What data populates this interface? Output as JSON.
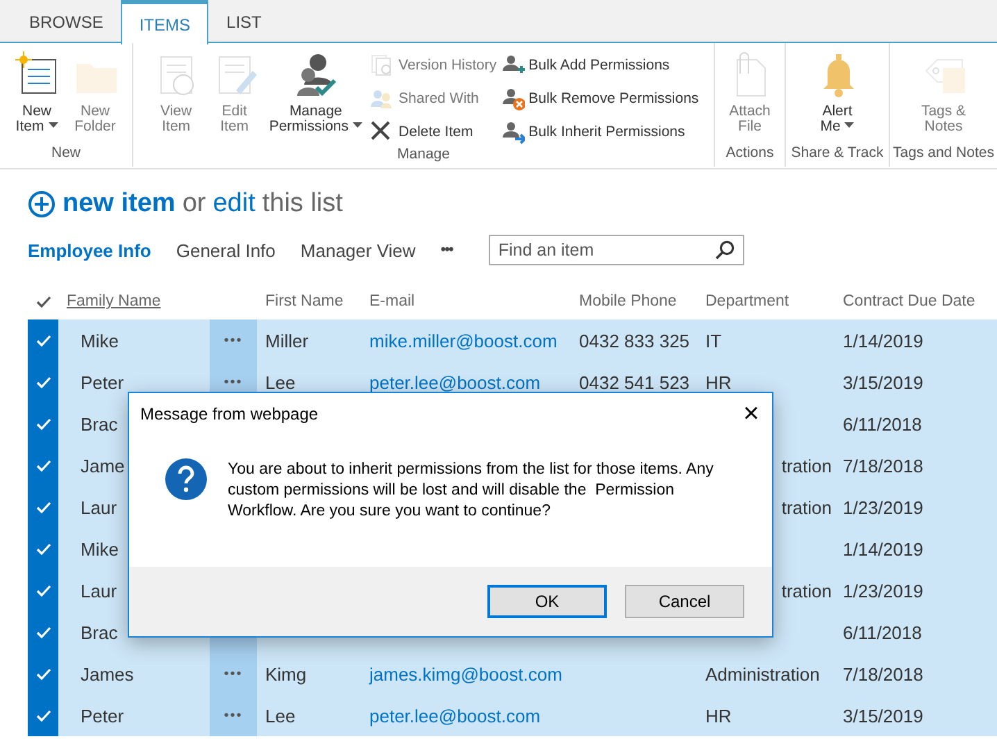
{
  "ribbon": {
    "tabs": [
      {
        "label": "BROWSE",
        "selected": false
      },
      {
        "label": "ITEMS",
        "selected": true
      },
      {
        "label": "LIST",
        "selected": false
      }
    ],
    "groups": [
      {
        "name": "New",
        "columns": [
          [
            {
              "kind": "large",
              "label_lines": [
                "New",
                "Item"
              ],
              "dropdown": true,
              "disabled": false
            }
          ],
          [
            {
              "kind": "large",
              "label_lines": [
                "New",
                "Folder"
              ],
              "dropdown": false,
              "disabled": true
            }
          ]
        ]
      },
      {
        "name": "Manage",
        "columns": [
          [
            {
              "kind": "large",
              "label_lines": [
                "View",
                "Item"
              ],
              "dropdown": false,
              "disabled": true
            }
          ],
          [
            {
              "kind": "large",
              "label_lines": [
                "Edit",
                "Item"
              ],
              "dropdown": false,
              "disabled": true
            }
          ],
          [
            {
              "kind": "large",
              "label_lines": [
                "Manage",
                "Permissions"
              ],
              "dropdown": true,
              "disabled": false
            }
          ],
          [
            {
              "kind": "small",
              "label_lines": [
                "Version History"
              ],
              "dropdown": false,
              "disabled": true
            },
            {
              "kind": "small",
              "label_lines": [
                "Shared With"
              ],
              "dropdown": false,
              "disabled": true
            },
            {
              "kind": "small",
              "label_lines": [
                "Delete Item"
              ],
              "dropdown": false,
              "disabled": false
            }
          ],
          [
            {
              "kind": "small",
              "label_lines": [
                "Bulk Add Permissions"
              ],
              "dropdown": false,
              "disabled": false
            },
            {
              "kind": "small",
              "label_lines": [
                "Bulk Remove Permissions"
              ],
              "dropdown": false,
              "disabled": false
            },
            {
              "kind": "small",
              "label_lines": [
                "Bulk Inherit Permissions"
              ],
              "dropdown": false,
              "disabled": false
            }
          ]
        ]
      },
      {
        "name": "Actions",
        "columns": [
          [
            {
              "kind": "large",
              "label_lines": [
                "Attach",
                "File"
              ],
              "dropdown": false,
              "disabled": true
            }
          ]
        ]
      },
      {
        "name": "Share & Track",
        "columns": [
          [
            {
              "kind": "large",
              "label_lines": [
                "Alert",
                "Me"
              ],
              "dropdown": true,
              "disabled": false
            }
          ]
        ]
      },
      {
        "name": "Tags and Notes",
        "columns": [
          [
            {
              "kind": "large",
              "label_lines": [
                "Tags &",
                "Notes"
              ],
              "dropdown": false,
              "disabled": true
            }
          ]
        ]
      }
    ]
  },
  "list": {
    "heading": {
      "new_item": "new item",
      "or": "or",
      "edit": "edit",
      "rest": "this list"
    },
    "views": [
      {
        "label": "Employee Info",
        "selected": true
      },
      {
        "label": "General Info",
        "selected": false
      },
      {
        "label": "Manager View",
        "selected": false
      }
    ],
    "more_views": "•••",
    "search": {
      "placeholder": "Find an item"
    },
    "columns": [
      {
        "label": "Family Name",
        "sorted": true
      },
      {
        "label": "First Name",
        "sorted": false
      },
      {
        "label": "E-mail",
        "sorted": false
      },
      {
        "label": "Mobile Phone",
        "sorted": false
      },
      {
        "label": "Department",
        "sorted": false
      },
      {
        "label": "Contract Due Date",
        "sorted": false
      }
    ],
    "rows": [
      {
        "kind": "full",
        "selected": true,
        "family_name": "Mike",
        "menu": "•••",
        "first_name": "Miller",
        "email": "mike.miller@boost.com",
        "mobile_phone": "0432 833 325",
        "department": "IT",
        "contract_due_date": "1/14/2019"
      },
      {
        "kind": "full",
        "selected": true,
        "family_name": "Peter",
        "menu": "•••",
        "first_name": "Lee",
        "email": "peter.lee@boost.com",
        "mobile_phone": "0432 541 523",
        "department": "HR",
        "contract_due_date": "3/15/2019"
      },
      {
        "kind": "covered",
        "selected": true,
        "family_name": "Brac",
        "contract_due_date": "6/11/2018"
      },
      {
        "kind": "covered",
        "selected": true,
        "family_name": "Jame",
        "department": "tration",
        "contract_due_date": "7/18/2018"
      },
      {
        "kind": "covered",
        "selected": true,
        "family_name": "Laur",
        "department": "tration",
        "contract_due_date": "1/23/2019"
      },
      {
        "kind": "covered",
        "selected": true,
        "family_name": "Mike",
        "contract_due_date": "1/14/2019"
      },
      {
        "kind": "covered",
        "selected": true,
        "family_name": "Laur",
        "department": "tration",
        "contract_due_date": "1/23/2019"
      },
      {
        "kind": "covered",
        "selected": true,
        "family_name": "Brac",
        "contract_due_date": "6/11/2018"
      },
      {
        "kind": "full",
        "selected": true,
        "family_name": "James",
        "menu": "•••",
        "first_name": "Kimg",
        "email": "james.kimg@boost.com",
        "department": "Administration",
        "contract_due_date": "7/18/2018"
      },
      {
        "kind": "full",
        "selected": true,
        "family_name": "Peter",
        "menu": "•••",
        "first_name": "Lee",
        "email": "peter.lee@boost.com",
        "department": "HR",
        "contract_due_date": "3/15/2019"
      }
    ]
  },
  "dialog": {
    "title": "Message from webpage",
    "close": "×",
    "message": "You are about to inherit permissions from the list for those items. Any custom permissions will be lost and will disable the  Permission Workflow. Are you sure you want to continue?",
    "buttons": [
      {
        "label": "OK",
        "selected": true
      },
      {
        "label": "Cancel",
        "selected": false
      }
    ]
  }
}
